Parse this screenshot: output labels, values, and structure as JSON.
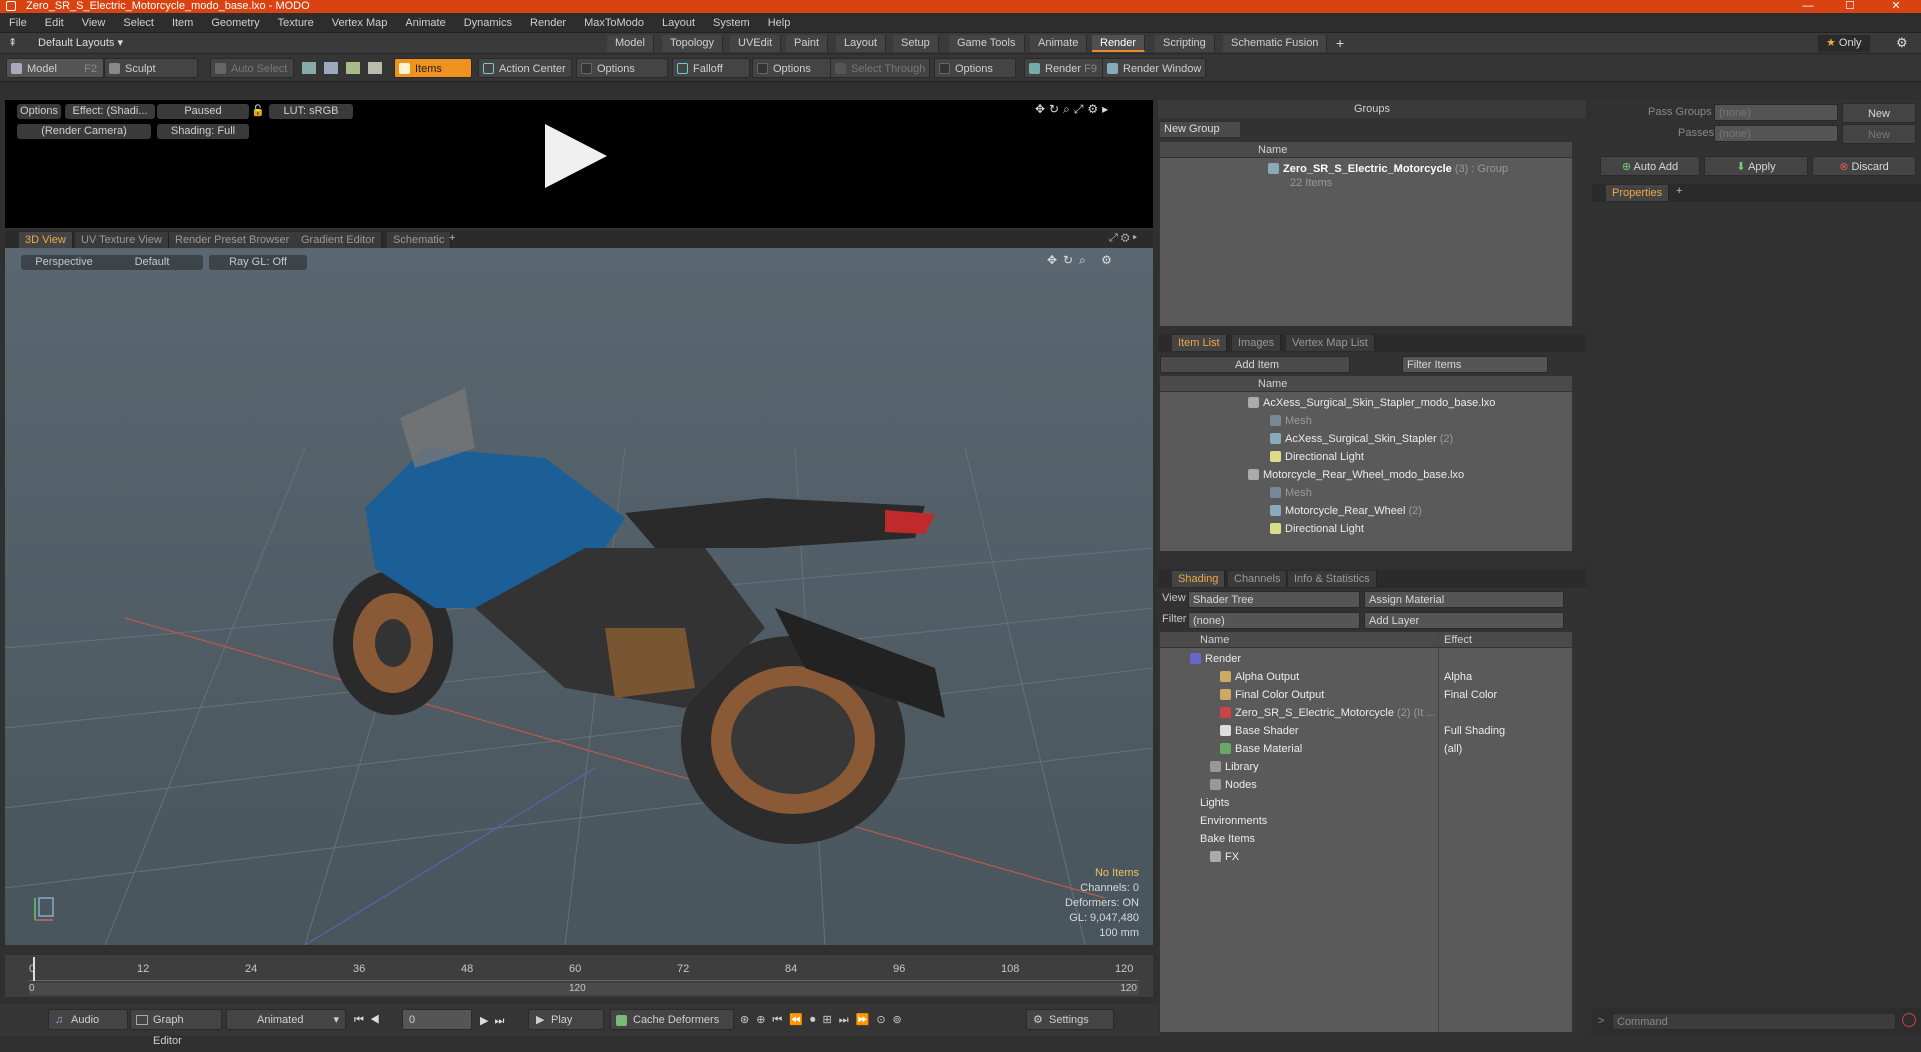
{
  "window": {
    "title": "Zero_SR_S_Electric_Motorcycle_modo_base.lxo - MODO"
  },
  "menu": [
    "File",
    "Edit",
    "View",
    "Select",
    "Item",
    "Geometry",
    "Texture",
    "Vertex Map",
    "Animate",
    "Dynamics",
    "Render",
    "MaxToModo",
    "Layout",
    "System",
    "Help"
  ],
  "layout_bar": {
    "preset": "Default Layouts ▾",
    "tabs": [
      "Model",
      "Topology",
      "UVEdit",
      "Paint",
      "Layout",
      "Setup",
      "Game Tools",
      "Animate",
      "Render",
      "Scripting",
      "Schematic Fusion"
    ],
    "active_tab": "Render",
    "only_label": "Only"
  },
  "toolbar": {
    "model": "Model",
    "model_key": "F2",
    "sculpt": "Sculpt",
    "auto_select": "Auto Select",
    "items": "Items",
    "action_center": "Action Center",
    "options1": "Options",
    "falloff": "Falloff",
    "options2": "Options",
    "select_through": "Select Through",
    "options3": "Options",
    "render": "Render",
    "render_key": "F9",
    "render_window": "Render Window"
  },
  "preview": {
    "options": "Options",
    "effect": "Effect: (Shadi...",
    "paused": "Paused",
    "lut": "LUT: sRGB",
    "camera": "(Render Camera)",
    "shading": "Shading: Full"
  },
  "view_tabs": [
    "3D View",
    "UV Texture View",
    "Render Preset Browser",
    "Gradient Editor",
    "Schematic"
  ],
  "viewport": {
    "projection": "Perspective",
    "style": "Default",
    "raygl": "Ray GL: Off",
    "stats": [
      "No Items",
      "Channels: 0",
      "Deformers: ON",
      "GL: 9,047,480",
      "100 mm"
    ]
  },
  "timeline": {
    "ticks": [
      "0",
      "12",
      "24",
      "36",
      "48",
      "60",
      "72",
      "84",
      "96",
      "108",
      "120"
    ],
    "range_start": "0",
    "range_mid": "120",
    "range_end": "120"
  },
  "bottom": {
    "audio": "Audio",
    "graph_editor": "Graph Editor",
    "animated": "Animated",
    "frame": "0",
    "play": "Play",
    "cache": "Cache Deformers",
    "settings": "Settings"
  },
  "groups": {
    "title": "Groups",
    "new_group": "New Group",
    "name_col": "Name",
    "item_name": "Zero_SR_S_Electric_Motorcycle",
    "item_suffix": "(3) : Group",
    "item_count": "22 Items"
  },
  "item_list": {
    "tabs": [
      "Item List",
      "Images",
      "Vertex Map List"
    ],
    "add_item": "Add Item",
    "filter": "Filter Items",
    "name_col": "Name",
    "rows": [
      {
        "label": "AcXess_Surgical_Skin_Stapler_modo_base.lxo",
        "suffix": ""
      },
      {
        "label": "Mesh",
        "suffix": ""
      },
      {
        "label": "AcXess_Surgical_Skin_Stapler",
        "suffix": "(2)"
      },
      {
        "label": "Directional Light",
        "suffix": ""
      },
      {
        "label": "Motorcycle_Rear_Wheel_modo_base.lxo",
        "suffix": ""
      },
      {
        "label": "Mesh",
        "suffix": ""
      },
      {
        "label": "Motorcycle_Rear_Wheel",
        "suffix": "(2)"
      },
      {
        "label": "Directional Light",
        "suffix": ""
      }
    ]
  },
  "shading": {
    "tabs": [
      "Shading",
      "Channels",
      "Info & Statistics"
    ],
    "view_label": "View",
    "view_value": "Shader Tree",
    "assign": "Assign Material",
    "filter_label": "Filter",
    "filter_value": "(none)",
    "add_layer": "Add Layer",
    "name_col": "Name",
    "effect_col": "Effect",
    "rows": [
      {
        "label": "Render",
        "effect": ""
      },
      {
        "label": "Alpha Output",
        "effect": "Alpha"
      },
      {
        "label": "Final Color Output",
        "effect": "Final Color"
      },
      {
        "label": "Zero_SR_S_Electric_Motorcycle",
        "effect": "",
        "suffix": "(2) (It ..."
      },
      {
        "label": "Base Shader",
        "effect": "Full Shading"
      },
      {
        "label": "Base Material",
        "effect": "(all)"
      },
      {
        "label": "Library",
        "effect": ""
      },
      {
        "label": "Nodes",
        "effect": ""
      },
      {
        "label": "Lights",
        "effect": ""
      },
      {
        "label": "Environments",
        "effect": ""
      },
      {
        "label": "Bake Items",
        "effect": ""
      },
      {
        "label": "FX",
        "effect": ""
      }
    ]
  },
  "right_panel": {
    "pass_groups": "Pass Groups",
    "passes": "Passes",
    "none": "(none)",
    "new": "New",
    "auto_add": "Auto Add",
    "apply": "Apply",
    "discard": "Discard",
    "properties": "Properties",
    "command": "Command"
  },
  "colors": {
    "accent": "#e88b2c",
    "title_bar": "#d94312",
    "items_active": "#f0921f"
  }
}
